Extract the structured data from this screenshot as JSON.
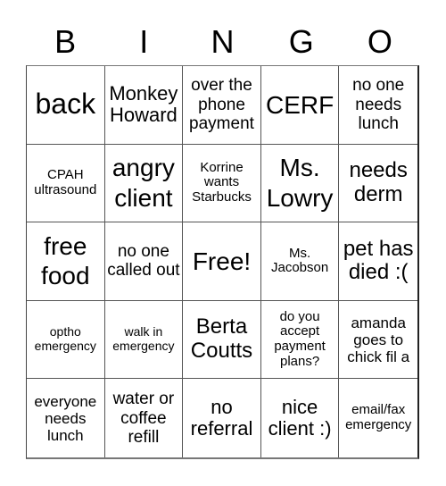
{
  "header": {
    "letters": [
      "B",
      "I",
      "N",
      "G",
      "O"
    ]
  },
  "cells": [
    "back",
    "Monkey Howard",
    "over the phone payment",
    "CERF",
    "no one needs lunch",
    "CPAH ultrasound",
    "angry client",
    "Korrine wants Starbucks",
    "Ms. Lowry",
    "needs derm",
    "free food",
    "no one called out",
    "Free!",
    "Ms. Jacobson",
    "pet has died :(",
    "optho emergency",
    "walk in emergency",
    "Berta Coutts",
    "do you accept payment plans?",
    "amanda goes to chick fil a",
    "everyone needs lunch",
    "water or coffee refill",
    "no referral",
    "nice client :)",
    "email/fax emergency"
  ]
}
